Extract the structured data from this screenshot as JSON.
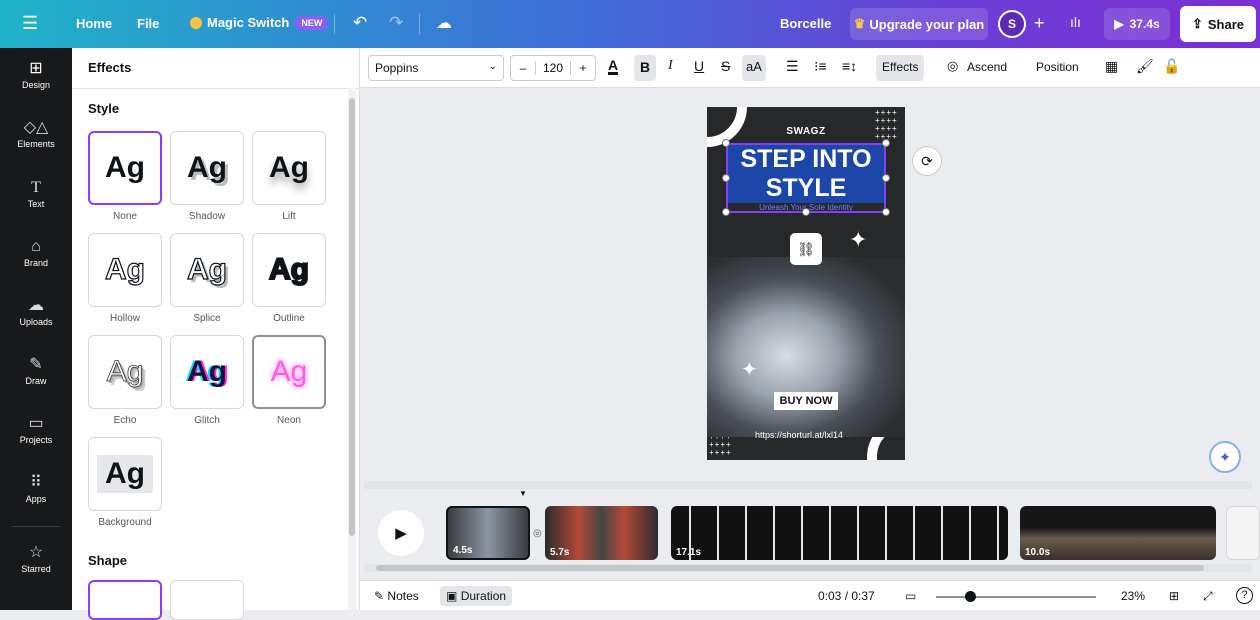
{
  "topbar": {
    "home": "Home",
    "file": "File",
    "magic_switch": "Magic Switch",
    "new_badge": "NEW",
    "brand_name": "Borcelle",
    "upgrade": "Upgrade your plan",
    "avatar": "S",
    "play_time": "37.4s",
    "share": "Share"
  },
  "rail": [
    {
      "label": "Design",
      "icon": "layout-icon"
    },
    {
      "label": "Elements",
      "icon": "shapes-icon"
    },
    {
      "label": "Text",
      "icon": "text-icon"
    },
    {
      "label": "Brand",
      "icon": "brand-icon"
    },
    {
      "label": "Uploads",
      "icon": "upload-cloud-icon"
    },
    {
      "label": "Draw",
      "icon": "pen-icon"
    },
    {
      "label": "Projects",
      "icon": "folder-icon"
    },
    {
      "label": "Apps",
      "icon": "grid-icon"
    },
    {
      "label": "Starred",
      "icon": "star-icon"
    }
  ],
  "panel": {
    "title": "Effects",
    "style_section": "Style",
    "shape_section": "Shape",
    "styles": [
      {
        "label": "None",
        "sample": "Ag"
      },
      {
        "label": "Shadow",
        "sample": "Ag"
      },
      {
        "label": "Lift",
        "sample": "Ag"
      },
      {
        "label": "Hollow",
        "sample": "Ag"
      },
      {
        "label": "Splice",
        "sample": "Ag"
      },
      {
        "label": "Outline",
        "sample": "Ag"
      },
      {
        "label": "Echo",
        "sample": "Ag"
      },
      {
        "label": "Glitch",
        "sample": "Ag"
      },
      {
        "label": "Neon",
        "sample": "Ag"
      },
      {
        "label": "Background",
        "sample": "Ag"
      }
    ],
    "selected_style": "None"
  },
  "toolbar": {
    "font": "Poppins",
    "font_size": "120",
    "minus": "–",
    "plus": "+",
    "bold": "B",
    "italic": "I",
    "underline": "U",
    "strike": "S",
    "case": "aA",
    "effects": "Effects",
    "ascend": "Ascend",
    "position": "Position",
    "text_color": "#0e1318"
  },
  "design": {
    "swagz": "SWAGZ",
    "title": "STEP INTO STYLE",
    "subtitle": "Unleash Your Sole Identity",
    "cta": "BUY NOW",
    "url": "https://shorturl.at/lxl14",
    "title_bg": "#1c46a8",
    "selection_color": "#8b3dff"
  },
  "timeline": {
    "clips": [
      {
        "label": "4.5s"
      },
      {
        "label": "5.7s"
      },
      {
        "label": "17.1s"
      },
      {
        "label": "10.0s"
      }
    ]
  },
  "bottombar": {
    "notes": "Notes",
    "duration": "Duration",
    "time": "0:03 / 0:37",
    "zoom": "23%",
    "help": "?"
  }
}
